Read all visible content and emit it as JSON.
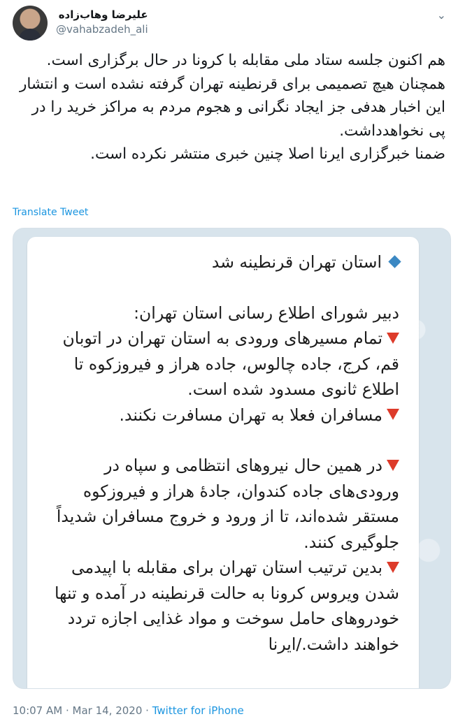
{
  "author": {
    "display_name": "علیرضا وهاب‌زاده",
    "handle": "@vahabzadeh_ali",
    "avatar_icon": "profile-photo"
  },
  "menu_icon": "chevron-down-icon",
  "tweet": {
    "paragraphs": [
      "هم اکنون جلسه ستاد ملی مقابله با کرونا در حال برگزاری است.",
      "همچنان هیچ تصمیمی برای قرنطینه تهران گرفته نشده است و انتشار این اخبار هدفی جز ایجاد نگرانی و هجوم مردم به مراکز خرید را در پی نخواهد‌داشت.",
      "ضمنا خبرگزاری ایرنا اصلا چنین خبری منتشر نکرده است."
    ]
  },
  "translate_label": "Translate Tweet",
  "media": {
    "title": "استان تهران قرنطینه شد",
    "subtitle": "دبیر شورای اطلاع رسانی استان تهران:",
    "items": [
      "تمام مسیرهای ورودی به استان تهران در اتوبان قم، کرج، جاده چالوس، جاده هراز و فیروزکوه تا اطلاع ثانوی مسدود شده است.",
      "مسافران فعلا به تهران مسافرت نکنند.",
      "در همین حال نیروهای انتظامی و سپاه در ورودی‌های جاده کندوان، جادهٔ هراز و فیروزکوه مستقر شده‌اند، تا از ورود و خروج مسافران شدیداً جلوگیری کنند.",
      "بدین ترتیب استان تهران برای مقابله با اپیدمی شدن ویروس کرونا به حالت قرنطینه در آمده و تنها خودروهای حامل سوخت و مواد غذایی اجازه تردد خواهند داشت./ایرنا"
    ],
    "colors": {
      "diamond": "#3b88c3",
      "triangle": "#dd3b2a",
      "background": "#d8e4ec"
    }
  },
  "footer": {
    "time": "10:07 AM",
    "separator": " · ",
    "date": "Mar 14, 2020",
    "source": "Twitter for iPhone"
  },
  "colors": {
    "link": "#1b95e0",
    "muted": "#657786",
    "text": "#14171a"
  }
}
